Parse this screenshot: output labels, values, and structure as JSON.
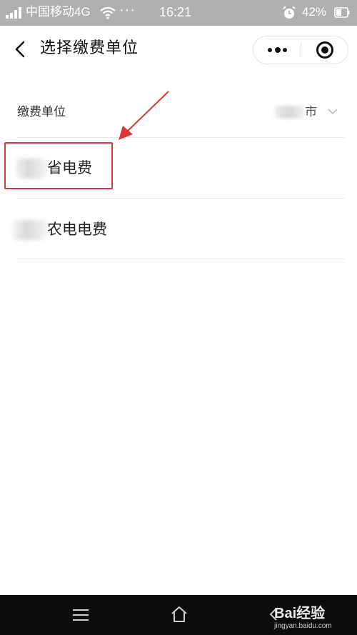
{
  "status_bar": {
    "carrier": "中国移动4G",
    "more": "···",
    "time": "16:21",
    "battery": "42%"
  },
  "nav": {
    "title": "选择缴费单位",
    "icons": [
      "back-icon",
      "more-dots-icon",
      "close-circle-icon"
    ]
  },
  "form": {
    "unit_label": "缴费单位",
    "unit_value_visible": "市"
  },
  "options": [
    {
      "label": "省电费",
      "highlighted": true
    },
    {
      "label": "农电电费",
      "highlighted": false
    }
  ],
  "annotation": {
    "color": "#d9383a"
  },
  "bottom_bar": {
    "icons": [
      "menu-icon",
      "home-icon",
      "back-icon"
    ]
  },
  "watermark": {
    "text": "Bai经验",
    "sub": "jingyan.baidu.com"
  }
}
